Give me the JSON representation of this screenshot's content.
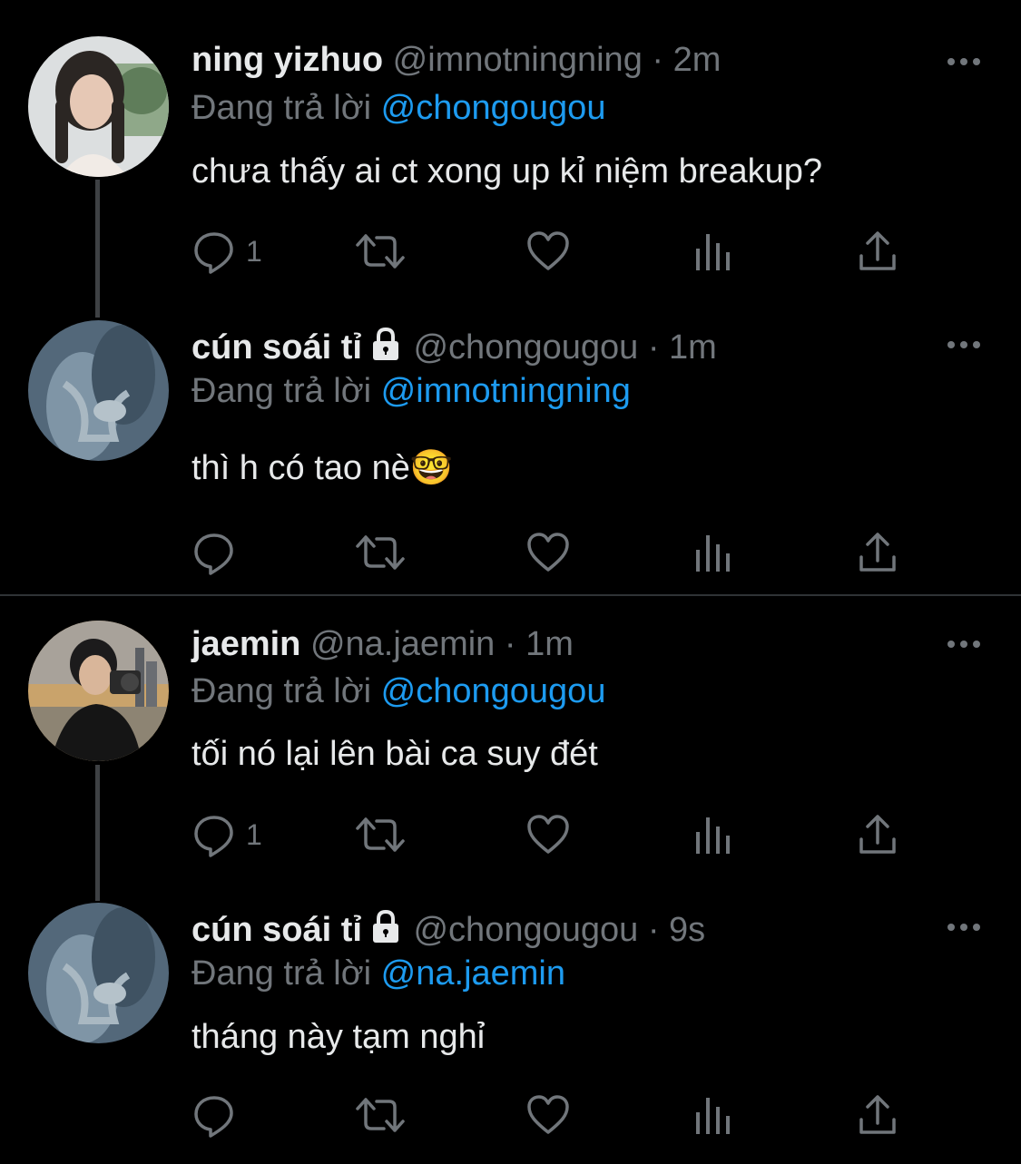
{
  "colors": {
    "background": "#000000",
    "text": "#e7e9ea",
    "muted": "#71767b",
    "link": "#1d9bf0",
    "line": "#3e4144"
  },
  "replying_prefix": "Đang trả lời",
  "tweets": [
    {
      "name": "ning yizhuo",
      "handle": "@imnotningning",
      "separator": "·",
      "time": "2m",
      "replying_to": "@chongougou",
      "text": "chưa thấy ai ct xong up kỉ niệm breakup?",
      "reply_count": "1",
      "locked": false,
      "avatar": "girl-braids-avatar"
    },
    {
      "name": "cún soái tỉ",
      "handle": "@chongougou",
      "separator": "·",
      "time": "1m",
      "replying_to": "@imnotningning",
      "text": "thì h có tao nè🤓",
      "reply_count": "",
      "locked": true,
      "avatar": "water-figure-avatar"
    },
    {
      "name": "jaemin",
      "handle": "@na.jaemin",
      "separator": "·",
      "time": "1m",
      "replying_to": "@chongougou",
      "text": "tối nó lại lên bài ca suy đét",
      "reply_count": "1",
      "locked": false,
      "avatar": "camera-boy-avatar"
    },
    {
      "name": "cún soái tỉ",
      "handle": "@chongougou",
      "separator": "·",
      "time": "9s",
      "replying_to": "@na.jaemin",
      "text": "tháng này tạm nghỉ",
      "reply_count": "",
      "locked": true,
      "avatar": "water-figure-avatar"
    }
  ],
  "icons": [
    "reply-icon",
    "retweet-icon",
    "like-icon",
    "views-icon",
    "share-icon",
    "more-icon",
    "lock-icon"
  ]
}
